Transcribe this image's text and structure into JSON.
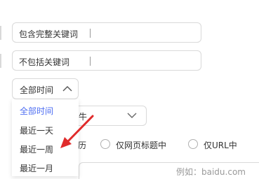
{
  "fields": {
    "include_phrase": {
      "value": "包含完整关键词"
    },
    "exclude_words": {
      "value": "不包括关键词"
    }
  },
  "time_filter": {
    "selected": "全部时间",
    "options": [
      "全部时间",
      "最近一天",
      "最近一周",
      "最近一月"
    ]
  },
  "filetype": {
    "partial_label": "牛"
  },
  "position": {
    "partial_label": "历",
    "options": [
      "仅网页标题中",
      "仅URL中"
    ]
  },
  "site": {
    "placeholder": "例如：baidu.com"
  },
  "colors": {
    "accent": "#4e6ef2",
    "annotation_arrow": "#e02b2b"
  }
}
